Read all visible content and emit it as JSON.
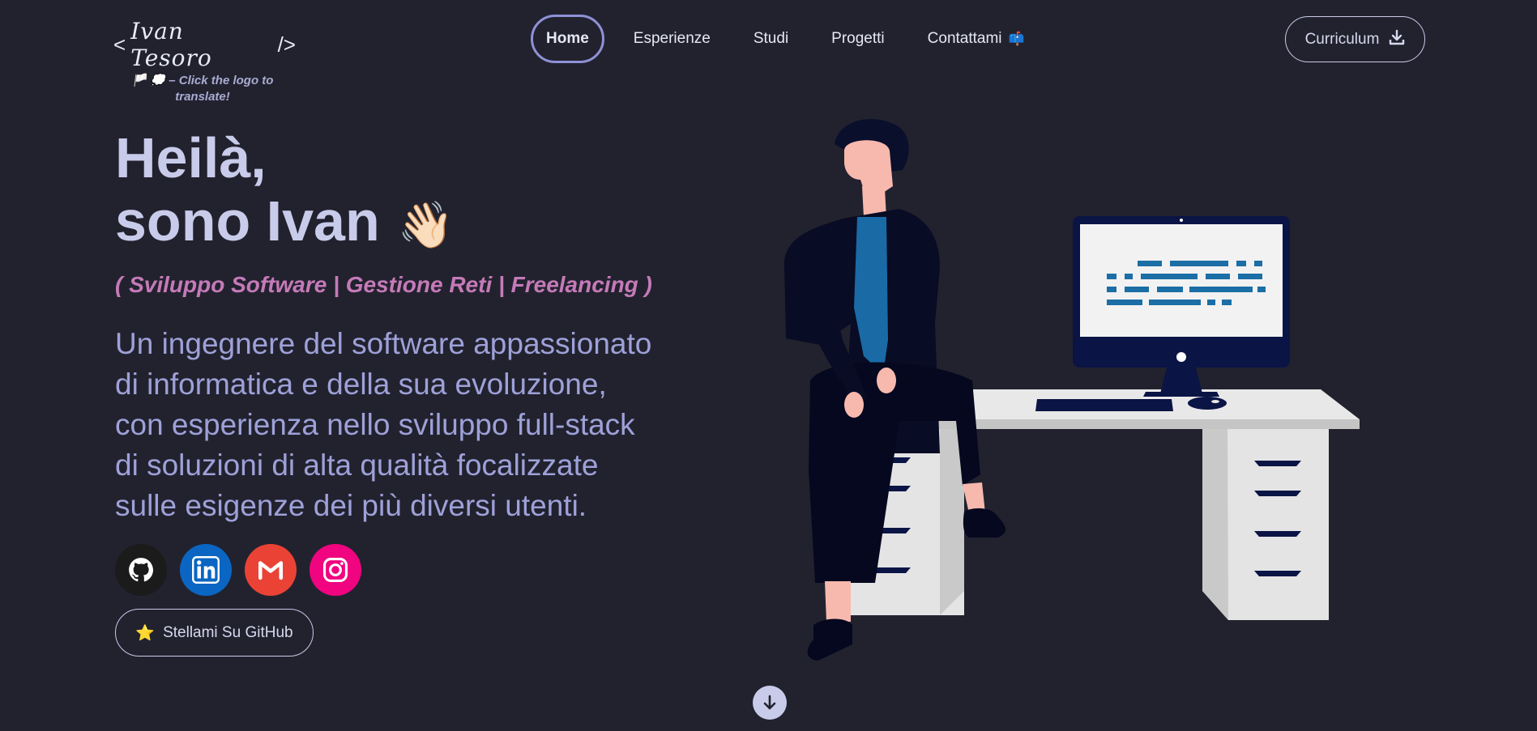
{
  "header": {
    "logo": {
      "open": "<",
      "signature": "Ivan Tesoro",
      "close": "/>"
    },
    "logo_note": "🏳️ 💭 – Click the logo to translate!",
    "nav": [
      {
        "label": "Home",
        "active": true
      },
      {
        "label": "Esperienze",
        "active": false
      },
      {
        "label": "Studi",
        "active": false
      },
      {
        "label": "Progetti",
        "active": false
      },
      {
        "label": "Contattami",
        "active": false,
        "icon": "mailbox-icon",
        "emoji": "📫"
      }
    ],
    "cv_button": {
      "label": "Curriculum",
      "icon": "download-icon"
    }
  },
  "hero": {
    "title_line1": "Heilà,",
    "title_line2": "sono Ivan",
    "wave_emoji": "👋🏻",
    "tagline": "( Sviluppo Software | Gestione Reti | Freelancing )",
    "description": [
      "Un ingegnere del software appassionato",
      "di informatica e della sua evoluzione,",
      "con esperienza nello sviluppo full-stack",
      "di soluzioni di alta qualità focalizzate",
      "sulle esigenze dei più diversi utenti."
    ],
    "socials": [
      {
        "name": "github",
        "icon": "github-icon",
        "color": "#1b1b1b"
      },
      {
        "name": "linkedin",
        "icon": "linkedin-icon",
        "color": "#0a66c2"
      },
      {
        "name": "gmail",
        "icon": "gmail-icon",
        "color": "#ea4335"
      },
      {
        "name": "instagram",
        "icon": "instagram-icon",
        "color": "#f0047f"
      }
    ],
    "star_button": {
      "emoji": "⭐",
      "label": "Stellami Su GitHub"
    }
  },
  "colors": {
    "background": "#22222f",
    "accent": "#8e91d6",
    "tagline": "#c57ab8",
    "text": "#9ea1d8"
  }
}
